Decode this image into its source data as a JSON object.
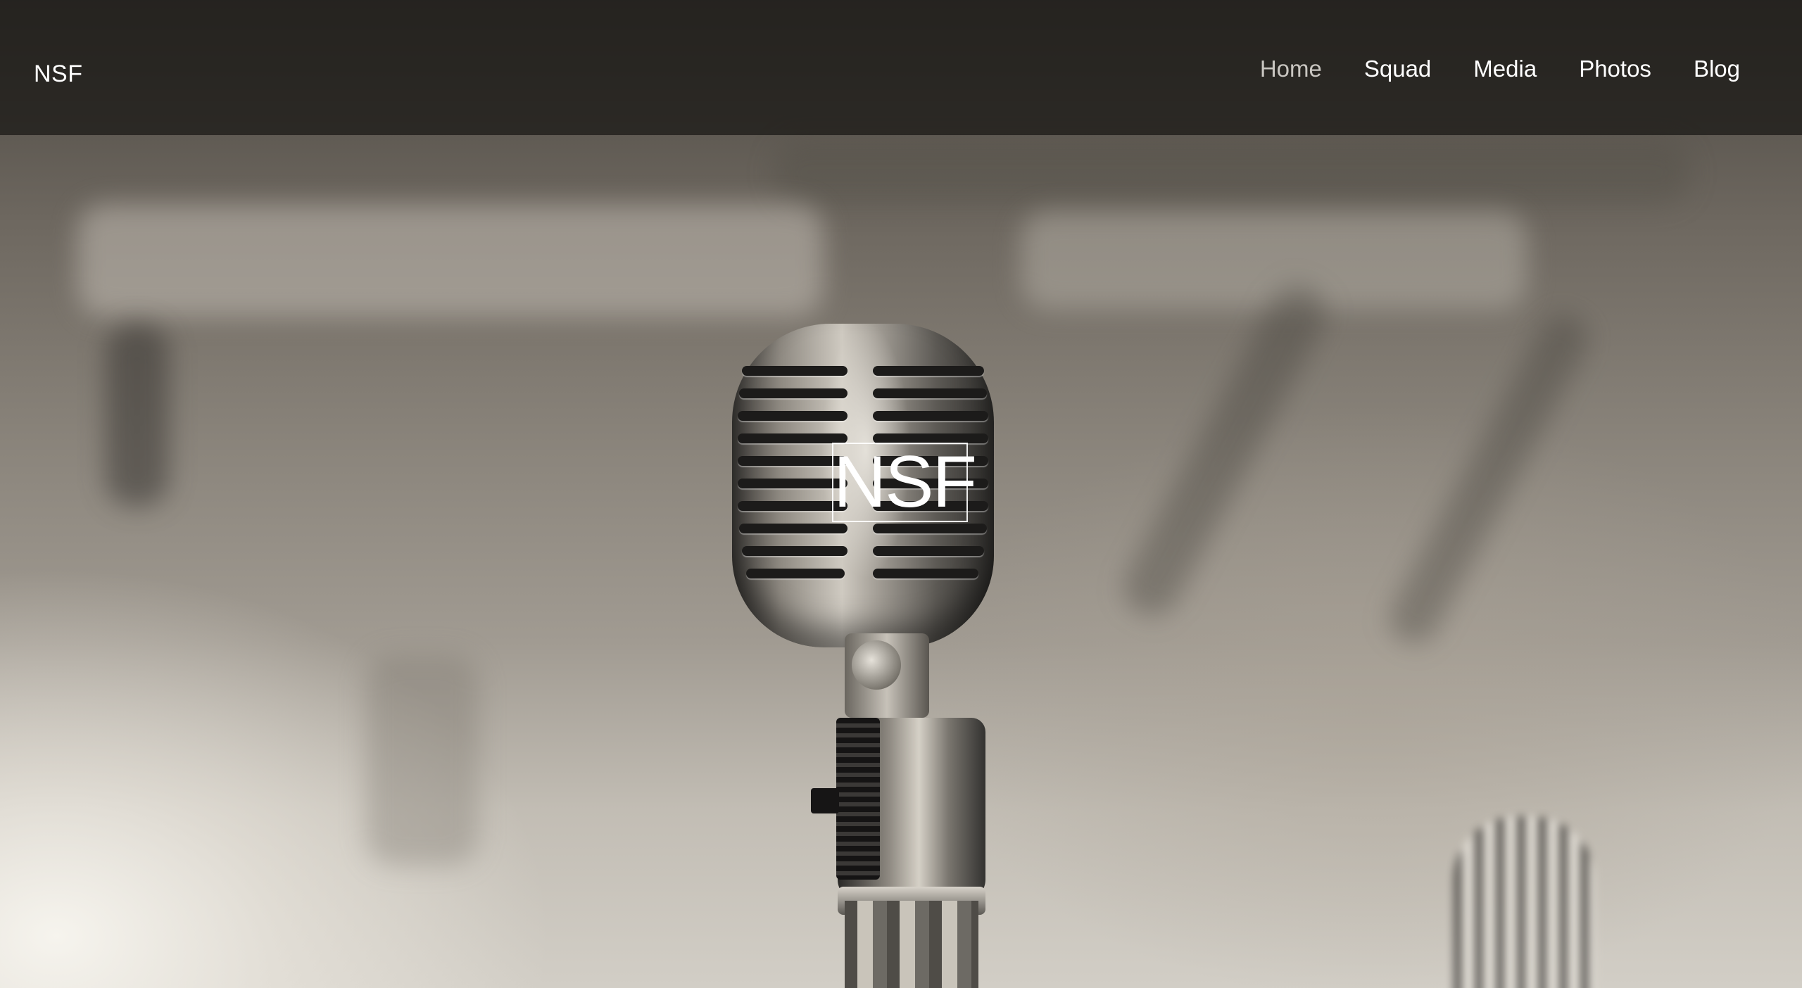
{
  "navbar": {
    "brand": "NSF",
    "items": [
      {
        "label": "Home",
        "active": true
      },
      {
        "label": "Squad",
        "active": false
      },
      {
        "label": "Media",
        "active": false
      },
      {
        "label": "Photos",
        "active": false
      },
      {
        "label": "Blog",
        "active": false
      }
    ]
  },
  "hero": {
    "title": "NSF"
  },
  "colors": {
    "navbar_bg": "#181614",
    "nav_text": "#ffffff",
    "nav_active_text": "#c9c6c1",
    "hero_text": "#ffffff"
  }
}
